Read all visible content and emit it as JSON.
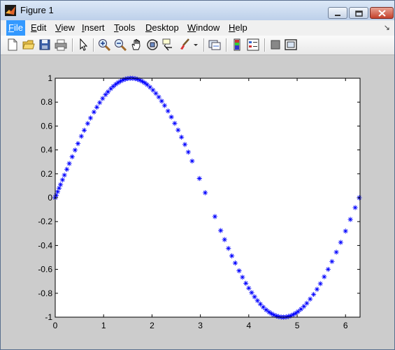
{
  "window": {
    "title": "Figure 1"
  },
  "menu": {
    "items": [
      {
        "mn": "F",
        "rest": "ile"
      },
      {
        "mn": "E",
        "rest": "dit"
      },
      {
        "mn": "V",
        "rest": "iew"
      },
      {
        "mn": "I",
        "rest": "nsert"
      },
      {
        "mn": "T",
        "rest": "ools"
      },
      {
        "mn": "D",
        "rest": "esktop"
      },
      {
        "mn": "W",
        "rest": "indow"
      },
      {
        "mn": "H",
        "rest": "elp"
      }
    ]
  },
  "toolbar": {
    "icons": [
      "new-figure-icon",
      "open-file-icon",
      "save-icon",
      "print-icon",
      "edit-plot-arrow-icon",
      "zoom-in-icon",
      "zoom-out-icon",
      "pan-hand-icon",
      "rotate-3d-icon",
      "data-cursor-icon",
      "brush-icon",
      "brush-dropdown-icon",
      "link-plot-icon",
      "insert-colorbar-icon",
      "insert-legend-icon",
      "hide-plot-tools-icon",
      "show-plot-tools-icon"
    ]
  },
  "chart_data": {
    "type": "scatter",
    "marker": "*",
    "color": "#0000ff",
    "function": "sin(x)",
    "x_sampling": "dense near 0, pi/2, 3pi/2, 2pi; sparse near pi",
    "x": [
      0,
      0.02,
      0.05,
      0.08,
      0.11,
      0.15,
      0.19,
      0.24,
      0.29,
      0.35,
      0.41,
      0.47,
      0.54,
      0.6,
      0.67,
      0.73,
      0.8,
      0.86,
      0.92,
      0.98,
      1.04,
      1.09,
      1.15,
      1.2,
      1.25,
      1.3,
      1.35,
      1.4,
      1.45,
      1.5,
      1.55,
      1.6,
      1.65,
      1.7,
      1.75,
      1.8,
      1.85,
      1.9,
      1.96,
      2.02,
      2.08,
      2.14,
      2.2,
      2.26,
      2.33,
      2.4,
      2.47,
      2.54,
      2.61,
      2.68,
      2.75,
      2.83,
      2.98,
      3.1,
      3.3,
      3.42,
      3.5,
      3.58,
      3.65,
      3.72,
      3.8,
      3.87,
      3.94,
      4.0,
      4.06,
      4.12,
      4.18,
      4.24,
      4.3,
      4.36,
      4.42,
      4.47,
      4.52,
      4.57,
      4.62,
      4.67,
      4.72,
      4.77,
      4.82,
      4.87,
      4.92,
      4.97,
      5.02,
      5.08,
      5.14,
      5.2,
      5.27,
      5.34,
      5.41,
      5.48,
      5.56,
      5.64,
      5.72,
      5.81,
      5.9,
      6.0,
      6.1,
      6.2,
      6.283
    ],
    "y_function_of_x": "sin",
    "xlim": [
      0,
      6.3
    ],
    "ylim": [
      -1,
      1
    ],
    "xticks": [
      0,
      1,
      2,
      3,
      4,
      5,
      6
    ],
    "yticks": [
      -1,
      -0.8,
      -0.6,
      -0.4,
      -0.2,
      0,
      0.2,
      0.4,
      0.6,
      0.8,
      1
    ],
    "xtick_labels": [
      "0",
      "1",
      "2",
      "3",
      "4",
      "5",
      "6"
    ],
    "ytick_labels": [
      "-1",
      "-0.8",
      "-0.6",
      "-0.4",
      "-0.2",
      "0",
      "0.2",
      "0.4",
      "0.6",
      "0.8",
      "1"
    ],
    "title": "",
    "xlabel": "",
    "ylabel": "",
    "grid": false
  }
}
